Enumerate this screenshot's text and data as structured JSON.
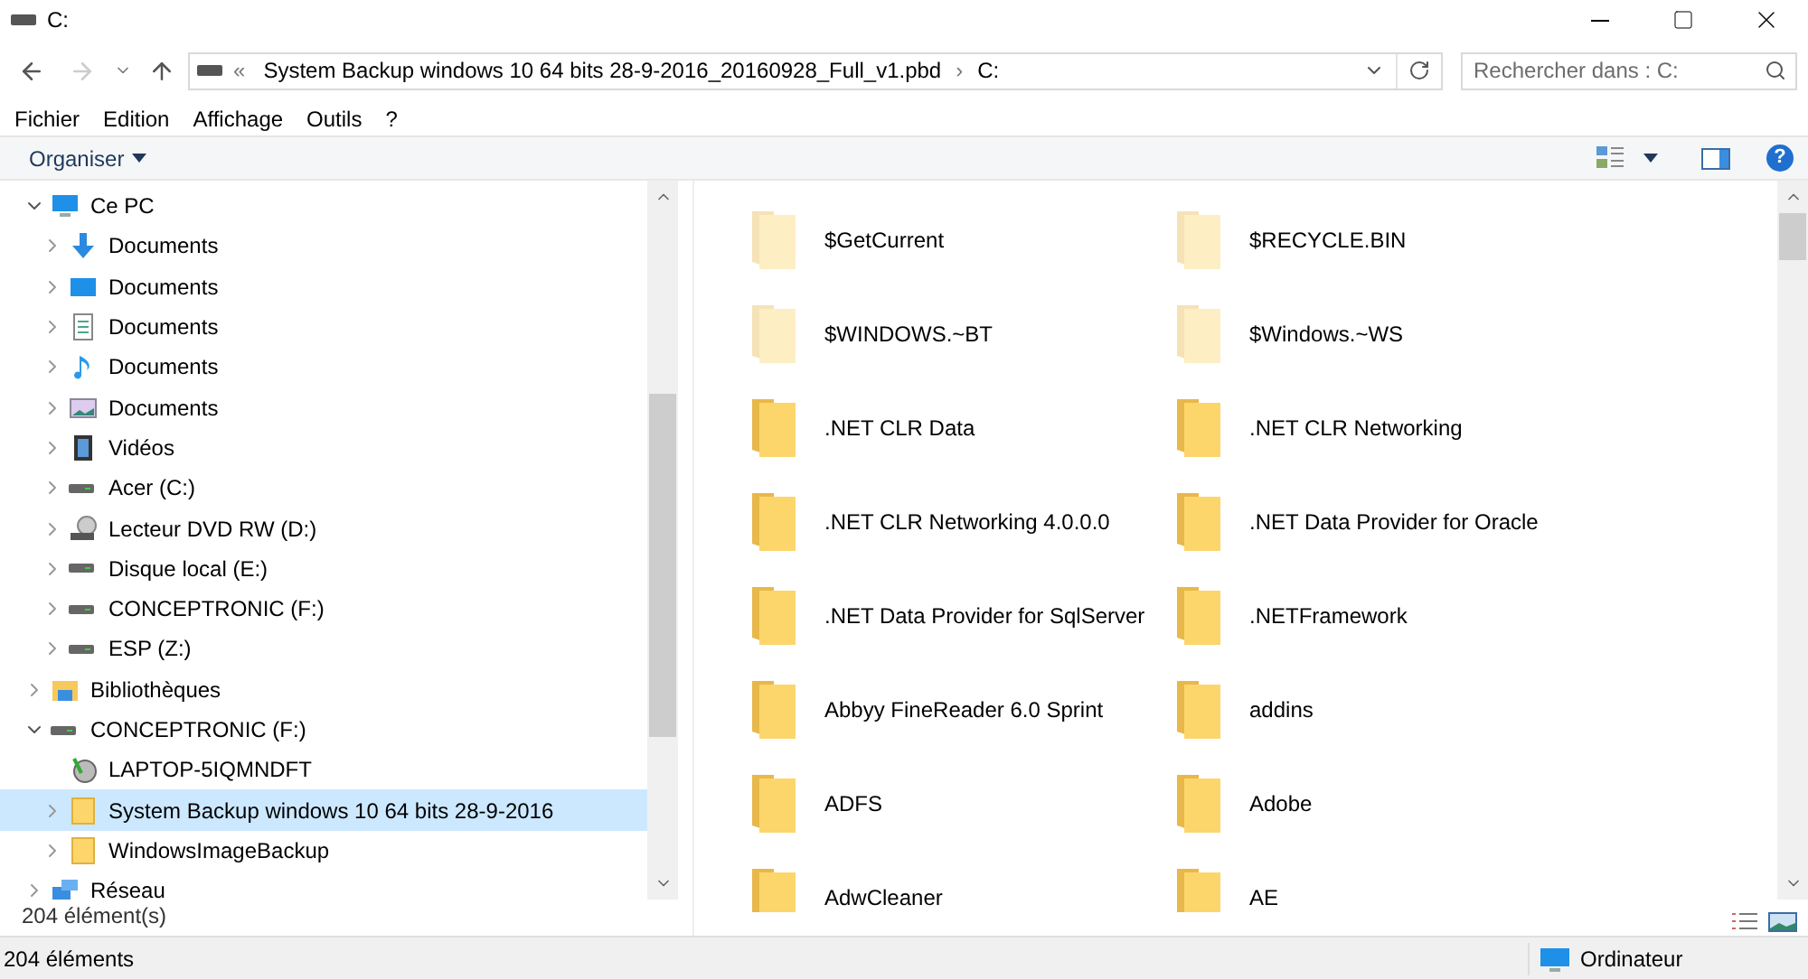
{
  "window": {
    "title": "C:"
  },
  "address_bar": {
    "overflow": "«",
    "segments": [
      {
        "label": "System Backup windows 10 64 bits 28-9-2016_20160928_Full_v1.pbd"
      },
      {
        "label": "C:"
      }
    ],
    "separator": "›"
  },
  "search": {
    "placeholder": "Rechercher dans : C:"
  },
  "menu": [
    "Fichier",
    "Edition",
    "Affichage",
    "Outils",
    "?"
  ],
  "toolbar": {
    "organize": "Organiser",
    "help": "?"
  },
  "tree": [
    {
      "label": "Ce PC",
      "kind": "pc",
      "expandable": true,
      "expanded": true,
      "selected": false,
      "children": [
        {
          "label": "Documents",
          "kind": "download",
          "expandable": true,
          "expanded": false,
          "selected": false
        },
        {
          "label": "Documents",
          "kind": "desktop",
          "expandable": true,
          "expanded": false,
          "selected": false
        },
        {
          "label": "Documents",
          "kind": "document",
          "expandable": true,
          "expanded": false,
          "selected": false
        },
        {
          "label": "Documents",
          "kind": "music",
          "expandable": true,
          "expanded": false,
          "selected": false
        },
        {
          "label": "Documents",
          "kind": "pictures",
          "expandable": true,
          "expanded": false,
          "selected": false
        },
        {
          "label": "Vidéos",
          "kind": "video",
          "expandable": true,
          "expanded": false,
          "selected": false
        },
        {
          "label": "Acer (C:)",
          "kind": "drive",
          "expandable": true,
          "expanded": false,
          "selected": false
        },
        {
          "label": "Lecteur DVD RW (D:)",
          "kind": "dvd",
          "expandable": true,
          "expanded": false,
          "selected": false
        },
        {
          "label": "Disque local (E:)",
          "kind": "drive",
          "expandable": true,
          "expanded": false,
          "selected": false
        },
        {
          "label": "CONCEPTRONIC (F:)",
          "kind": "drive",
          "expandable": true,
          "expanded": false,
          "selected": false
        },
        {
          "label": "ESP (Z:)",
          "kind": "drive",
          "expandable": true,
          "expanded": false,
          "selected": false
        }
      ]
    },
    {
      "label": "Bibliothèques",
      "kind": "library",
      "expandable": true,
      "expanded": false,
      "selected": false
    },
    {
      "label": "CONCEPTRONIC (F:)",
      "kind": "drive",
      "expandable": true,
      "expanded": true,
      "selected": false,
      "children": [
        {
          "label": "LAPTOP-5IQMNDFT",
          "kind": "backup",
          "expandable": false,
          "expanded": false,
          "selected": false
        },
        {
          "label": "System Backup windows 10 64 bits 28-9-2016",
          "kind": "folder",
          "expandable": true,
          "expanded": false,
          "selected": true
        },
        {
          "label": "WindowsImageBackup",
          "kind": "folder",
          "expandable": true,
          "expanded": false,
          "selected": false
        }
      ]
    },
    {
      "label": "Réseau",
      "kind": "network",
      "expandable": true,
      "expanded": false,
      "selected": false
    }
  ],
  "tree_footer": "204 élément(s)",
  "files": [
    {
      "name": "$GetCurrent",
      "hidden": true
    },
    {
      "name": "$RECYCLE.BIN",
      "hidden": true
    },
    {
      "name": "$WINDOWS.~BT",
      "hidden": true
    },
    {
      "name": "$Windows.~WS",
      "hidden": true
    },
    {
      "name": ".NET CLR Data",
      "hidden": false
    },
    {
      "name": ".NET CLR Networking",
      "hidden": false
    },
    {
      "name": ".NET CLR Networking 4.0.0.0",
      "hidden": false
    },
    {
      "name": ".NET Data Provider for Oracle",
      "hidden": false
    },
    {
      "name": ".NET Data Provider for SqlServer",
      "hidden": false
    },
    {
      "name": ".NETFramework",
      "hidden": false
    },
    {
      "name": "Abbyy FineReader 6.0 Sprint",
      "hidden": false
    },
    {
      "name": "addins",
      "hidden": false
    },
    {
      "name": "ADFS",
      "hidden": false
    },
    {
      "name": "Adobe",
      "hidden": false
    },
    {
      "name": "AdwCleaner",
      "hidden": false
    },
    {
      "name": "AE",
      "hidden": false
    }
  ],
  "status_bar": {
    "count": "204 éléments",
    "location": "Ordinateur"
  }
}
